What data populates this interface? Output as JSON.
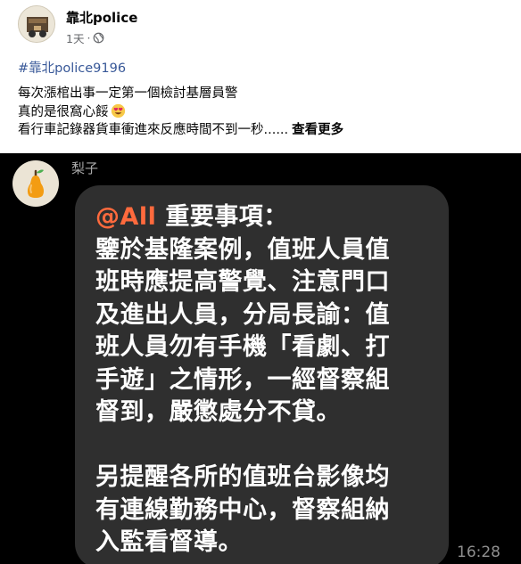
{
  "post": {
    "author": "靠北police",
    "time_ago": "1天",
    "separator": "·",
    "hashtag": "#靠北police9196",
    "lines": [
      "每次漲棺出事一定第一個檢討基層員警",
      "真的是很窩心餒",
      "看行車記錄器貨車衝進來反應時間不到一秒......"
    ],
    "see_more": "查看更多",
    "emoji_icon": "heart-eyes-emoji-icon",
    "privacy_icon": "globe-icon"
  },
  "chat": {
    "sender": "梨子",
    "mention": "@All",
    "lines": [
      "重要事項：",
      "鑒於基隆案例，值班人員值",
      "班時應提高警覺、注意門口",
      "及進出人員，分局長諭：值",
      "班人員勿有手機「看劇、打",
      "手遊」之情形，一經督察組",
      "督到，嚴懲處分不貸。",
      "另提醒各所的值班台影像均",
      "有連線勤務中心，督察組納",
      "入監看督導。"
    ],
    "time": "16:28",
    "colors": {
      "background": "#000000",
      "bubble": "#2f2f2f",
      "mention": "#ff6a3d",
      "text": "#ffffff"
    }
  }
}
